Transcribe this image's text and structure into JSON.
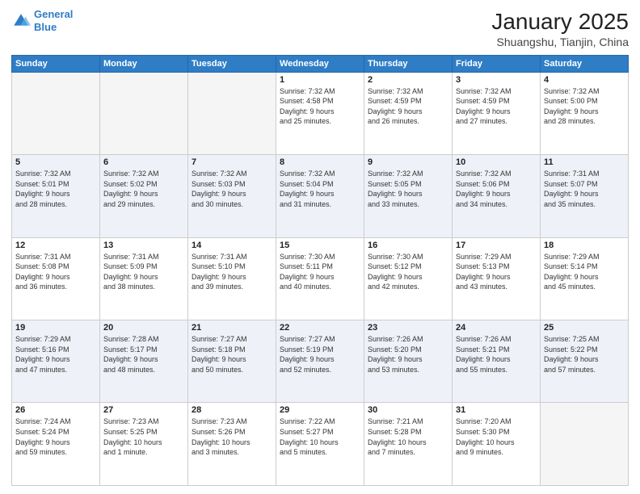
{
  "header": {
    "logo_line1": "General",
    "logo_line2": "Blue",
    "main_title": "January 2025",
    "sub_title": "Shuangshu, Tianjin, China"
  },
  "weekdays": [
    "Sunday",
    "Monday",
    "Tuesday",
    "Wednesday",
    "Thursday",
    "Friday",
    "Saturday"
  ],
  "weeks": [
    [
      {
        "day": "",
        "info": ""
      },
      {
        "day": "",
        "info": ""
      },
      {
        "day": "",
        "info": ""
      },
      {
        "day": "1",
        "info": "Sunrise: 7:32 AM\nSunset: 4:58 PM\nDaylight: 9 hours\nand 25 minutes."
      },
      {
        "day": "2",
        "info": "Sunrise: 7:32 AM\nSunset: 4:59 PM\nDaylight: 9 hours\nand 26 minutes."
      },
      {
        "day": "3",
        "info": "Sunrise: 7:32 AM\nSunset: 4:59 PM\nDaylight: 9 hours\nand 27 minutes."
      },
      {
        "day": "4",
        "info": "Sunrise: 7:32 AM\nSunset: 5:00 PM\nDaylight: 9 hours\nand 28 minutes."
      }
    ],
    [
      {
        "day": "5",
        "info": "Sunrise: 7:32 AM\nSunset: 5:01 PM\nDaylight: 9 hours\nand 28 minutes."
      },
      {
        "day": "6",
        "info": "Sunrise: 7:32 AM\nSunset: 5:02 PM\nDaylight: 9 hours\nand 29 minutes."
      },
      {
        "day": "7",
        "info": "Sunrise: 7:32 AM\nSunset: 5:03 PM\nDaylight: 9 hours\nand 30 minutes."
      },
      {
        "day": "8",
        "info": "Sunrise: 7:32 AM\nSunset: 5:04 PM\nDaylight: 9 hours\nand 31 minutes."
      },
      {
        "day": "9",
        "info": "Sunrise: 7:32 AM\nSunset: 5:05 PM\nDaylight: 9 hours\nand 33 minutes."
      },
      {
        "day": "10",
        "info": "Sunrise: 7:32 AM\nSunset: 5:06 PM\nDaylight: 9 hours\nand 34 minutes."
      },
      {
        "day": "11",
        "info": "Sunrise: 7:31 AM\nSunset: 5:07 PM\nDaylight: 9 hours\nand 35 minutes."
      }
    ],
    [
      {
        "day": "12",
        "info": "Sunrise: 7:31 AM\nSunset: 5:08 PM\nDaylight: 9 hours\nand 36 minutes."
      },
      {
        "day": "13",
        "info": "Sunrise: 7:31 AM\nSunset: 5:09 PM\nDaylight: 9 hours\nand 38 minutes."
      },
      {
        "day": "14",
        "info": "Sunrise: 7:31 AM\nSunset: 5:10 PM\nDaylight: 9 hours\nand 39 minutes."
      },
      {
        "day": "15",
        "info": "Sunrise: 7:30 AM\nSunset: 5:11 PM\nDaylight: 9 hours\nand 40 minutes."
      },
      {
        "day": "16",
        "info": "Sunrise: 7:30 AM\nSunset: 5:12 PM\nDaylight: 9 hours\nand 42 minutes."
      },
      {
        "day": "17",
        "info": "Sunrise: 7:29 AM\nSunset: 5:13 PM\nDaylight: 9 hours\nand 43 minutes."
      },
      {
        "day": "18",
        "info": "Sunrise: 7:29 AM\nSunset: 5:14 PM\nDaylight: 9 hours\nand 45 minutes."
      }
    ],
    [
      {
        "day": "19",
        "info": "Sunrise: 7:29 AM\nSunset: 5:16 PM\nDaylight: 9 hours\nand 47 minutes."
      },
      {
        "day": "20",
        "info": "Sunrise: 7:28 AM\nSunset: 5:17 PM\nDaylight: 9 hours\nand 48 minutes."
      },
      {
        "day": "21",
        "info": "Sunrise: 7:27 AM\nSunset: 5:18 PM\nDaylight: 9 hours\nand 50 minutes."
      },
      {
        "day": "22",
        "info": "Sunrise: 7:27 AM\nSunset: 5:19 PM\nDaylight: 9 hours\nand 52 minutes."
      },
      {
        "day": "23",
        "info": "Sunrise: 7:26 AM\nSunset: 5:20 PM\nDaylight: 9 hours\nand 53 minutes."
      },
      {
        "day": "24",
        "info": "Sunrise: 7:26 AM\nSunset: 5:21 PM\nDaylight: 9 hours\nand 55 minutes."
      },
      {
        "day": "25",
        "info": "Sunrise: 7:25 AM\nSunset: 5:22 PM\nDaylight: 9 hours\nand 57 minutes."
      }
    ],
    [
      {
        "day": "26",
        "info": "Sunrise: 7:24 AM\nSunset: 5:24 PM\nDaylight: 9 hours\nand 59 minutes."
      },
      {
        "day": "27",
        "info": "Sunrise: 7:23 AM\nSunset: 5:25 PM\nDaylight: 10 hours\nand 1 minute."
      },
      {
        "day": "28",
        "info": "Sunrise: 7:23 AM\nSunset: 5:26 PM\nDaylight: 10 hours\nand 3 minutes."
      },
      {
        "day": "29",
        "info": "Sunrise: 7:22 AM\nSunset: 5:27 PM\nDaylight: 10 hours\nand 5 minutes."
      },
      {
        "day": "30",
        "info": "Sunrise: 7:21 AM\nSunset: 5:28 PM\nDaylight: 10 hours\nand 7 minutes."
      },
      {
        "day": "31",
        "info": "Sunrise: 7:20 AM\nSunset: 5:30 PM\nDaylight: 10 hours\nand 9 minutes."
      },
      {
        "day": "",
        "info": ""
      }
    ]
  ]
}
